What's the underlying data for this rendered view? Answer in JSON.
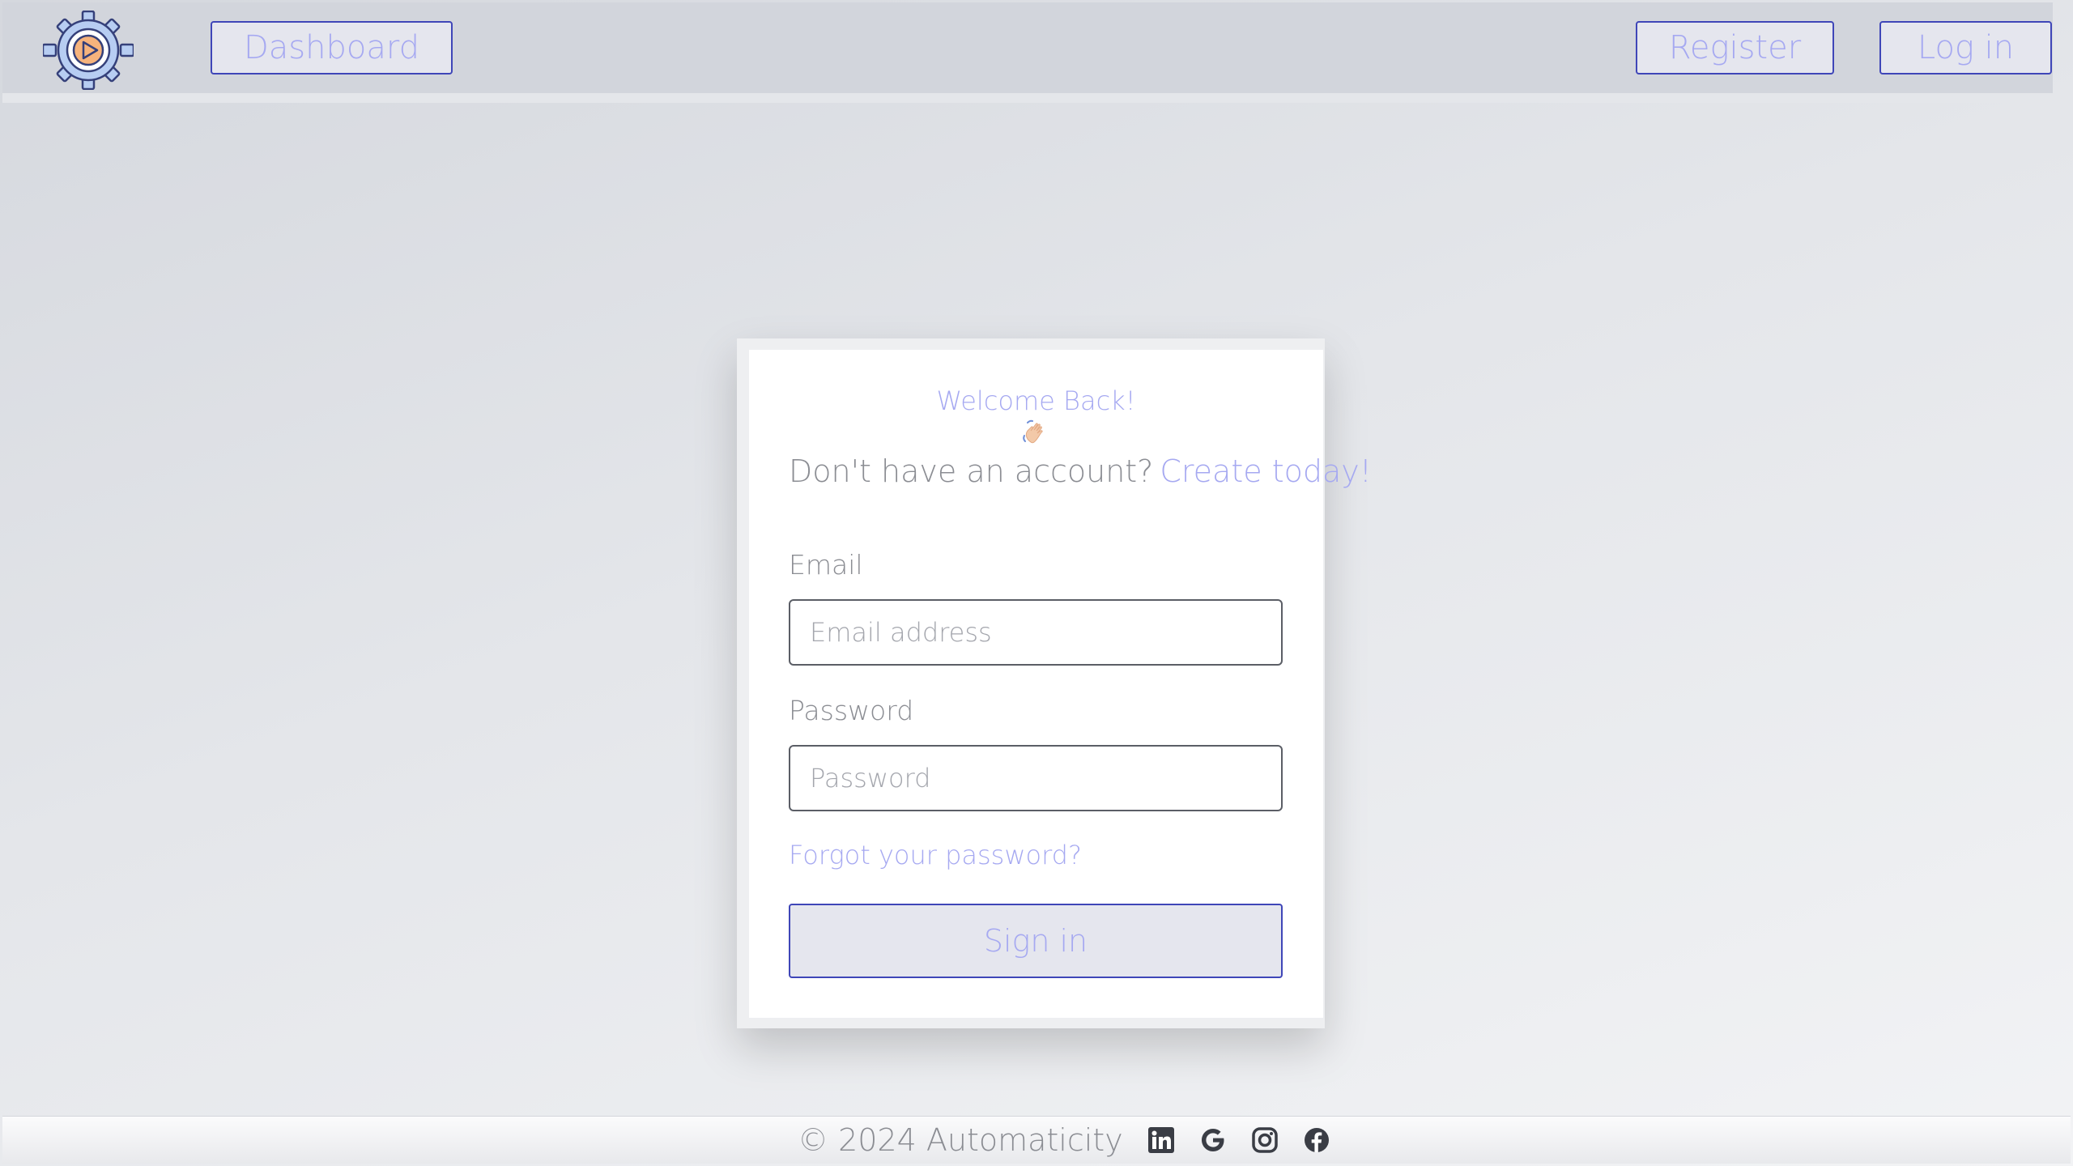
{
  "navbar": {
    "logo_alt": "gear-play-logo",
    "dashboard_label": "Dashboard",
    "register_label": "Register",
    "login_label": "Log in"
  },
  "login": {
    "welcome": "Welcome Back!",
    "wave_icon": "waving-hand-icon",
    "no_account_text": "Don't have an account?",
    "create_link": "Create today!",
    "email_label": "Email",
    "email_placeholder": "Email address",
    "email_value": "",
    "password_label": "Password",
    "password_placeholder": "Password",
    "password_value": "",
    "forgot_link": "Forgot your password?",
    "signin_label": "Sign in"
  },
  "footer": {
    "copyright": "© 2024 Automaticity",
    "social_icons": [
      "linkedin-icon",
      "google-icon",
      "instagram-icon",
      "facebook-icon"
    ]
  },
  "colors": {
    "accent_text": "#a6a9f1",
    "accent_border": "#3f46b8",
    "navbar_bg": "#d2d5dc",
    "button_bg": "#e5e6ee",
    "muted_text": "#8b8d93",
    "logo_orange": "#f6b37c",
    "logo_blue": "#b7cdf2",
    "logo_outline": "#35407a"
  }
}
